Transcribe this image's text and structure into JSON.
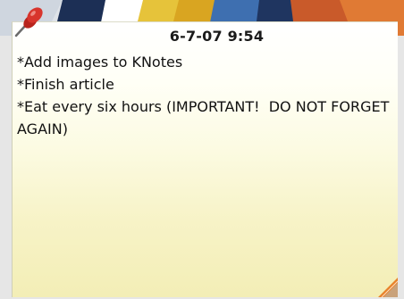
{
  "note": {
    "title": "6-7-07 9:54",
    "lines": [
      "*Add images to KNotes",
      "*Finish article",
      "*Eat every six hours (IMPORTANT!  DO NOT FORGET AGAIN)"
    ]
  },
  "icons": {
    "pin": "pushpin-icon",
    "resize": "resize-grip-icon"
  },
  "colors": {
    "note_top": "#ffffff",
    "note_bottom": "#f3eeb6",
    "pin_red": "#d8342c",
    "grip_orange": "#e8822a"
  }
}
